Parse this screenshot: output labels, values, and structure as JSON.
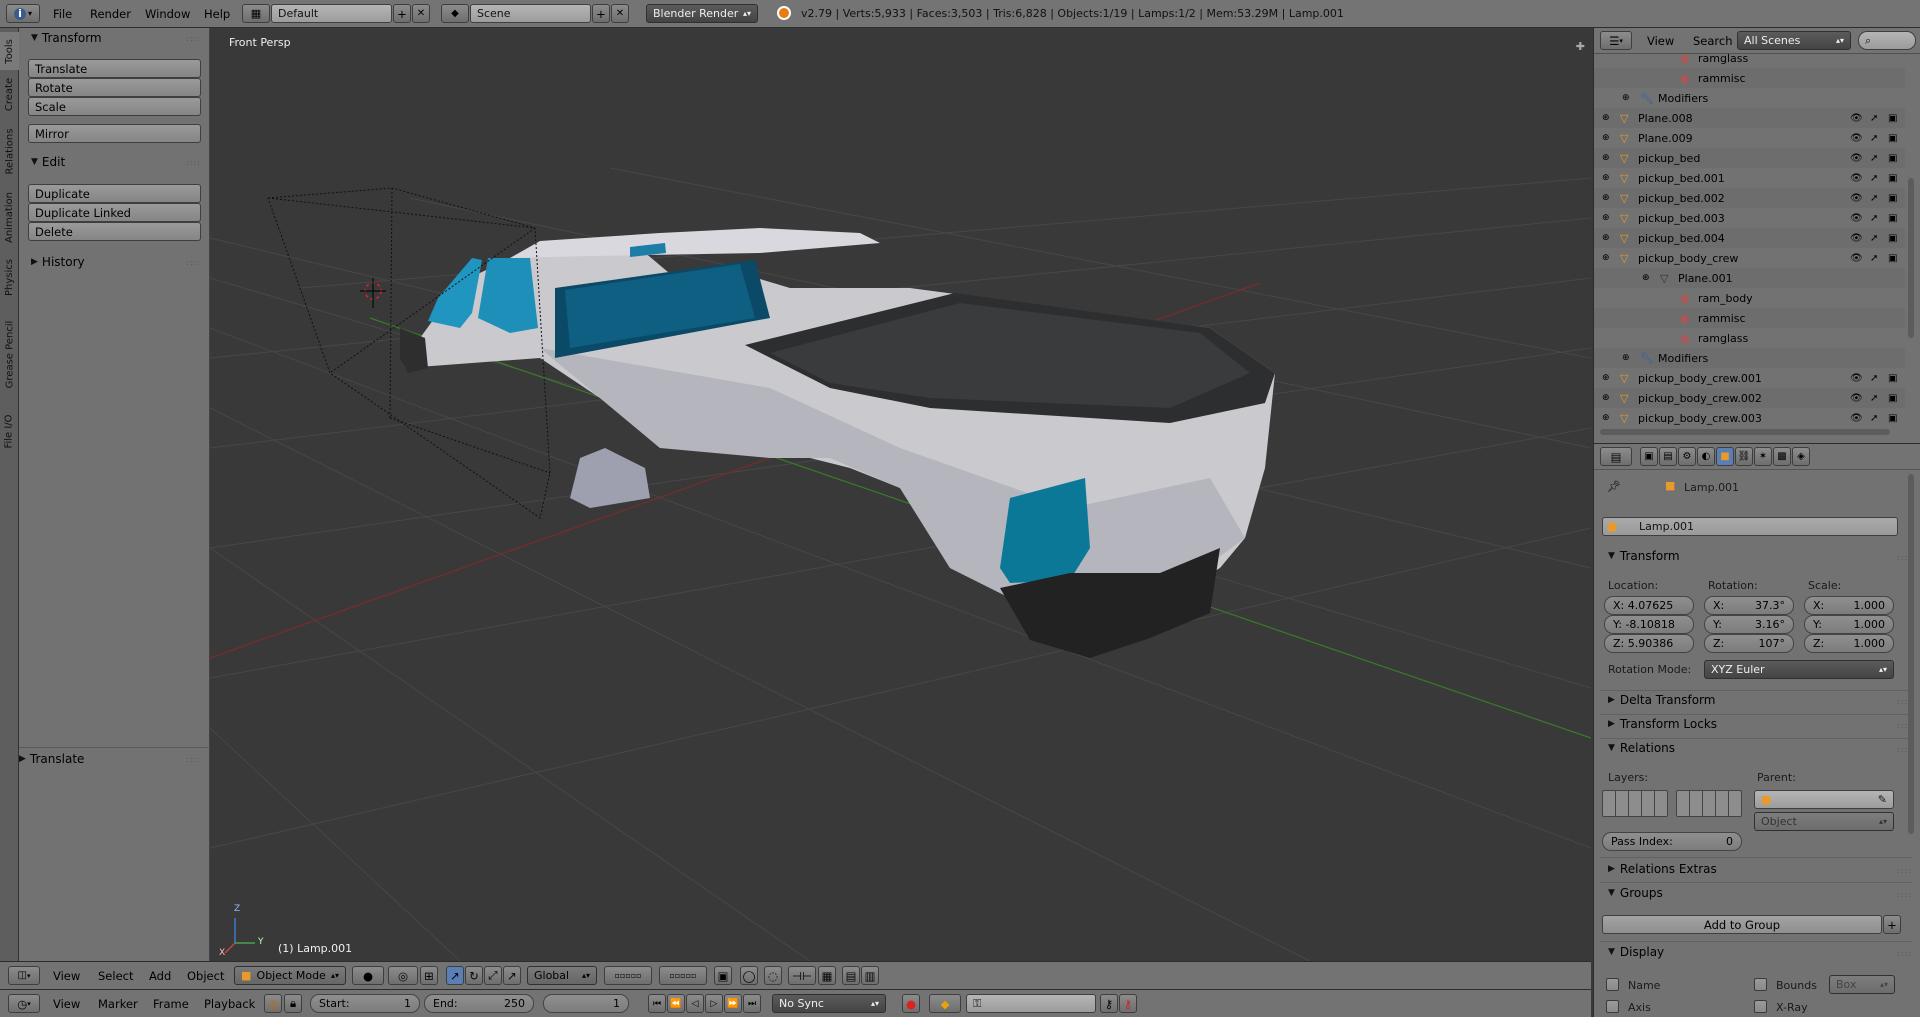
{
  "top": {
    "menus": [
      "File",
      "Render",
      "Window",
      "Help"
    ],
    "layout": "Default",
    "scene": "Scene",
    "engine": "Blender Render",
    "stats": "v2.79 | Verts:5,933 | Faces:3,503 | Tris:6,828 | Objects:1/19 | Lamps:1/2 | Mem:53.29M | Lamp.001"
  },
  "tabs": [
    "Tools",
    "Create",
    "Relations",
    "Animation",
    "Physics",
    "Grease Pencil",
    "File I/O"
  ],
  "toolshelf": {
    "transform_title": "Transform",
    "transform_buttons": [
      "Translate",
      "Rotate",
      "Scale"
    ],
    "mirror": "Mirror",
    "edit_title": "Edit",
    "edit_buttons": [
      "Duplicate",
      "Duplicate Linked",
      "Delete"
    ],
    "history": "History",
    "operator": "Translate"
  },
  "viewport": {
    "view_label": "Front Persp",
    "object_label": "(1) Lamp.001",
    "axis_x": "X",
    "axis_y": "Y",
    "axis_z": "Z"
  },
  "viewport_header": {
    "menus": [
      "View",
      "Select",
      "Add",
      "Object"
    ],
    "mode": "Object Mode",
    "orientation": "Global"
  },
  "timeline": {
    "menus": [
      "View",
      "Marker",
      "Frame",
      "Playback"
    ],
    "start_label": "Start:",
    "start": "1",
    "end_label": "End:",
    "end": "250",
    "current": "1",
    "sync": "No Sync"
  },
  "outliner": {
    "view": "View",
    "search": "Search",
    "filter": "All Scenes",
    "rows": [
      {
        "name": "ramglass",
        "type": "material",
        "indent": 4,
        "ops": false
      },
      {
        "name": "rammisc",
        "type": "material",
        "indent": 4,
        "ops": false
      },
      {
        "name": "Modifiers",
        "type": "modifiers",
        "indent": 2,
        "ops": false
      },
      {
        "name": "Plane.008",
        "type": "mesh",
        "indent": 1,
        "ops": true
      },
      {
        "name": "Plane.009",
        "type": "mesh",
        "indent": 1,
        "ops": true
      },
      {
        "name": "pickup_bed",
        "type": "mesh",
        "indent": 1,
        "ops": true
      },
      {
        "name": "pickup_bed.001",
        "type": "mesh",
        "indent": 1,
        "ops": true
      },
      {
        "name": "pickup_bed.002",
        "type": "mesh",
        "indent": 1,
        "ops": true
      },
      {
        "name": "pickup_bed.003",
        "type": "mesh",
        "indent": 1,
        "ops": true
      },
      {
        "name": "pickup_bed.004",
        "type": "mesh",
        "indent": 1,
        "ops": true
      },
      {
        "name": "pickup_body_crew",
        "type": "mesh",
        "indent": 1,
        "ops": true
      },
      {
        "name": "Plane.001",
        "type": "meshdata",
        "indent": 3,
        "ops": false
      },
      {
        "name": "ram_body",
        "type": "material",
        "indent": 4,
        "ops": false
      },
      {
        "name": "rammisc",
        "type": "material",
        "indent": 4,
        "ops": false
      },
      {
        "name": "ramglass",
        "type": "material",
        "indent": 4,
        "ops": false
      },
      {
        "name": "Modifiers",
        "type": "modifiers",
        "indent": 2,
        "ops": false
      },
      {
        "name": "pickup_body_crew.001",
        "type": "mesh",
        "indent": 1,
        "ops": true
      },
      {
        "name": "pickup_body_crew.002",
        "type": "mesh",
        "indent": 1,
        "ops": true
      },
      {
        "name": "pickup_body_crew.003",
        "type": "mesh",
        "indent": 1,
        "ops": true
      }
    ]
  },
  "properties": {
    "breadcrumb": "Lamp.001",
    "object_name": "Lamp.001",
    "transform": "Transform",
    "location_label": "Location:",
    "rotation_label": "Rotation:",
    "scale_label": "Scale:",
    "loc": [
      "X:  4.07625",
      "Y:  -8.10818",
      "Z:  5.90386"
    ],
    "rot": [
      "X:",
      "Y:",
      "Z:"
    ],
    "rot_vals": [
      "37.3°",
      "3.16°",
      "107°"
    ],
    "scl": [
      "X:",
      "Y:",
      "Z:"
    ],
    "scl_vals": [
      "1.000",
      "1.000",
      "1.000"
    ],
    "rotation_mode_label": "Rotation Mode:",
    "rotation_mode": "XYZ Euler",
    "delta": "Delta Transform",
    "locks": "Transform Locks",
    "relations": "Relations",
    "layers_label": "Layers:",
    "parent_label": "Parent:",
    "parent_type": "Object",
    "pass_label": "Pass Index:",
    "pass_value": "0",
    "relations_extras": "Relations Extras",
    "groups": "Groups",
    "add_group": "Add to Group",
    "display": "Display",
    "disp_name": "Name",
    "disp_axis": "Axis",
    "disp_bounds": "Bounds",
    "disp_xray": "X-Ray",
    "disp_box": "Box"
  }
}
